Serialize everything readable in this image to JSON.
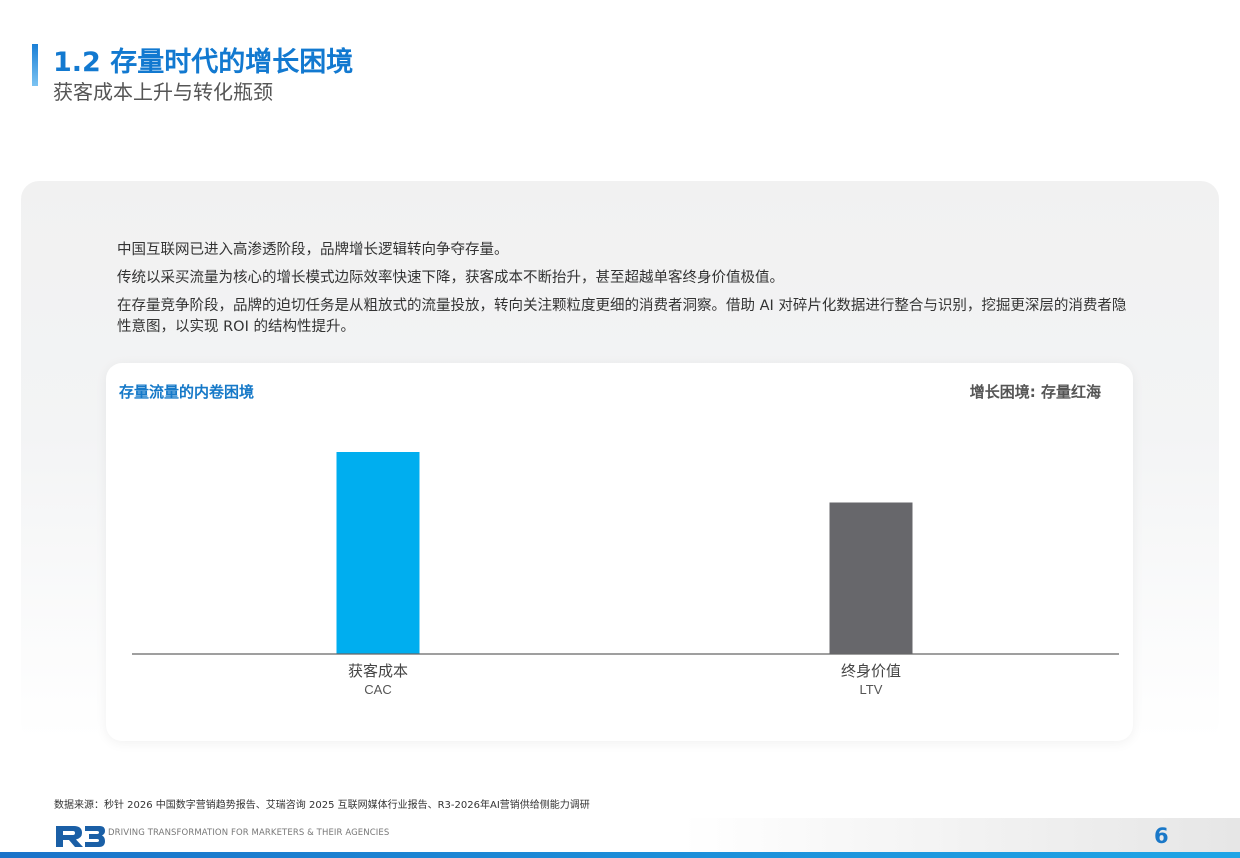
{
  "header": {
    "title": "1.2 存量时代的增长困境",
    "subtitle": "获客成本上升与转化瓶颈"
  },
  "intro": {
    "p1": "中国互联网已进入高渗透阶段，品牌增长逻辑转向争夺存量。",
    "p2": "传统以采买流量为核心的增长模式边际效率快速下降，获客成本不断抬升，甚至超越单客终身价值极值。",
    "p3": "在存量竞争阶段，品牌的迫切任务是从粗放式的流量投放，转向关注颗粒度更细的消费者洞察。借助 AI 对碎片化数据进行整合与识别，挖掘更深层的消费者隐性意图，以实现 ROI 的结构性提升。"
  },
  "card": {
    "title": "存量流量的内卷困境",
    "right_label": "增长困境: 存量红海"
  },
  "chart_data": {
    "type": "bar",
    "categories": [
      "获客成本",
      "终身价值"
    ],
    "category_sublabels": [
      "CAC",
      "LTV"
    ],
    "values": [
      100,
      75
    ],
    "colors": [
      "#00aeef",
      "#67676b"
    ],
    "ylim": [
      0,
      100
    ],
    "grid": false,
    "title": "存量流量的内卷困境",
    "xlabel": "",
    "ylabel": ""
  },
  "source": "数据来源：秒针 2026 中国数字营销趋势报告、艾瑞咨询 2025 互联网媒体行业报告、R3-2026年AI营销供给侧能力调研",
  "footer": {
    "logo_text": "R3",
    "tagline": "DRIVING TRANSFORMATION FOR MARKETERS & THEIR AGENCIES",
    "page_number": "6",
    "accent": "#1a78c8"
  }
}
